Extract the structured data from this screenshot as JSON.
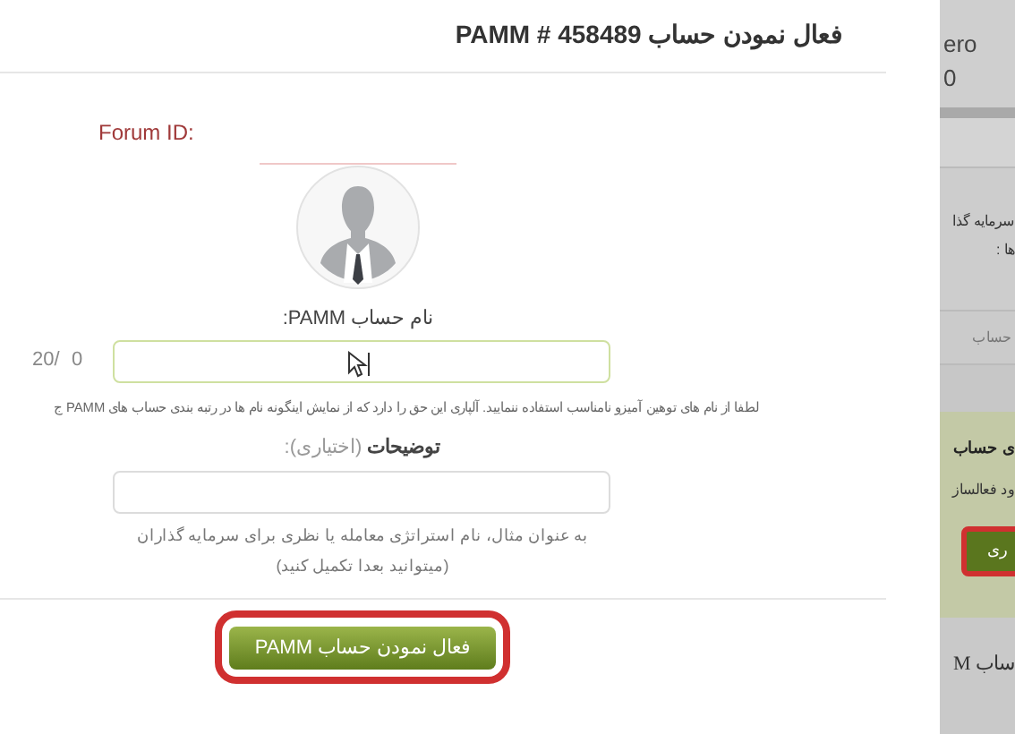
{
  "dialog": {
    "title": "فعال نمودن حساب PAMM # 458489",
    "forum_id_label": "Forum ID:",
    "name_field": {
      "label": "نام حساب PAMM:",
      "max": "20/",
      "counter": "0",
      "hint": "لطفا از نام های توهین آمیزو نامناسب استفاده ننمایید. آلپاری این حق را دارد که از نمایش اینگونه نام ها در رتبه بندی حساب های PAMM ج"
    },
    "description_field": {
      "label": "**توضیحات** (اختیاری):",
      "help": [
        "به عنوان مثال، نام استراتژی معامله یا نظری برای سرمایه گذاران",
        "(میتوانید بعدا تکمیل کنید)"
      ]
    },
    "submit_button": {
      "label": "فعال نمودن حساب PAMM",
      "highlighted": true
    }
  },
  "background_page": {
    "top_lines": [
      "ero",
      "0"
    ],
    "investor_lines": [
      "سرمایه گذا",
      "ها :"
    ],
    "tab": "حساب",
    "green_box": {
      "heading": "ی حساب",
      "text": "ود فعالساز",
      "button": "ری",
      "highlighted": true
    },
    "bottom_heading": "ساب M"
  }
}
